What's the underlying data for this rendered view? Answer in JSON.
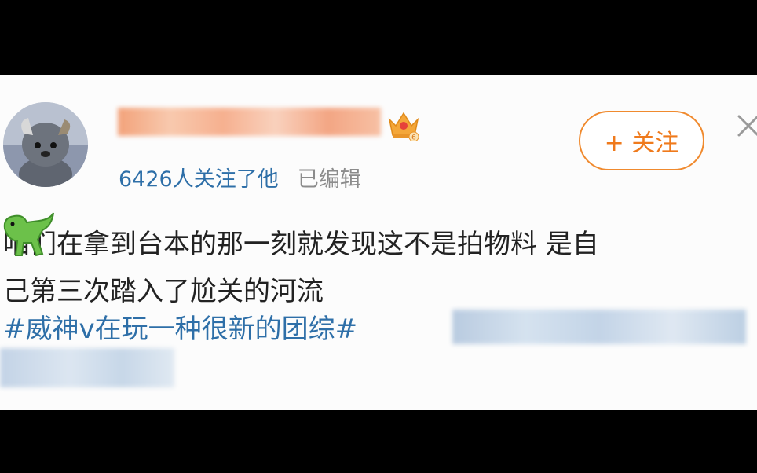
{
  "user": {
    "followers_text": "6426人关注了他",
    "edited_text": "已编辑",
    "badge_level": "6"
  },
  "actions": {
    "follow_label": "+ 关注"
  },
  "post": {
    "line1": "咱们在拿到台本的那一刻就发现这不是拍物料 是自",
    "line2": "己第三次踏入了尬关的河流",
    "hashtag": "#威神v在玩一种很新的团综#"
  },
  "colors": {
    "accent_orange": "#ef7a1c",
    "link_blue": "#2e6fa8",
    "text": "#222222",
    "muted": "#8c8c8c"
  }
}
